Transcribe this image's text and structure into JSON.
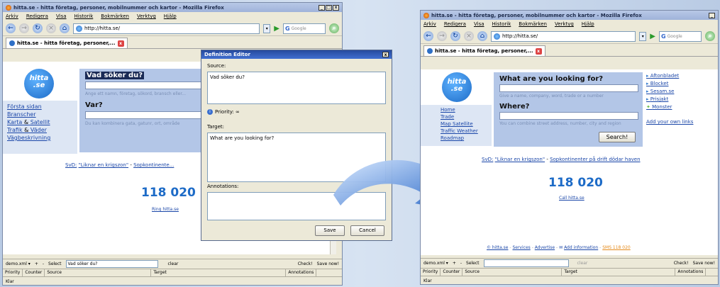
{
  "window_title": "hitta.se - hitta företag, personer, mobilnummer och kartor - Mozilla Firefox",
  "menu": [
    "Arkiv",
    "Redigera",
    "Visa",
    "Historik",
    "Bokmärken",
    "Verktyg",
    "Hjälp"
  ],
  "url": "http://hitta.se/",
  "search_placeholder": "Google",
  "tab_title": "hitta.se - hitta företag, personer,...",
  "logo_text": [
    "hitta",
    ".se"
  ],
  "left_before": {
    "links": [
      "Första sidan",
      "Branscher"
    ],
    "pairs": [
      [
        "Karta",
        "&",
        "Satellit"
      ],
      [
        "Trafik",
        "&",
        "Väder"
      ]
    ],
    "last": "Vägbeskrivning",
    "heading1": "Vad söker du?",
    "hint1": "Ange ett namn, företag, sökord, bransch eller...",
    "heading2": "Var?",
    "hint2": "Du kan kombinera gata, gatunr, ort, område",
    "news": [
      "SvD:",
      "\"Liknar en krigszon\"",
      "-",
      "Sopkontinente..."
    ],
    "number": "118 020",
    "call": "Ring hitta.se"
  },
  "dialog": {
    "title": "Definition Editor",
    "source_label": "Source:",
    "source_value": "Vad söker du?",
    "priority_label": "Priority: ∞",
    "target_label": "Target:",
    "target_value": "What are you looking for?",
    "annotations_label": "Annotations:",
    "save": "Save",
    "cancel": "Cancel"
  },
  "status_before": {
    "file": "demo.xml ▾",
    "plus": "+",
    "minus": "-",
    "select_label": "Select",
    "select_value": "Vad söker du?",
    "clear": "clear",
    "check": "Check!",
    "save_now": "Save now!",
    "cols": [
      "Priority",
      "Counter",
      "Source",
      "Target",
      "Annotations"
    ],
    "status": "Klar"
  },
  "after": {
    "links": [
      "Home",
      "Trade"
    ],
    "pair1": [
      "Map",
      "Satellite"
    ],
    "pair2": [
      "Traffic",
      "Weather"
    ],
    "last": "Roadmap",
    "heading1": "What are you looking for?",
    "hint1": "Give a name, company, word, trade or a number",
    "heading2": "Where?",
    "hint2": "You can combine street address, number, city and region",
    "search_button": "Search!",
    "side_links": [
      "Aftonbladet",
      "Blocket",
      "Sesam.se",
      "Prisjakt",
      "Monster"
    ],
    "add_links": "Add your own links",
    "news": [
      "SvD:",
      "\"Liknar en krigszon\"",
      "-",
      "Sopkontinenter på drift dödar haven"
    ],
    "number": "118 020",
    "call": "Call hitta.se",
    "footer": [
      "© hitta.se",
      "Services",
      "Advertise",
      "Add information",
      "SMS 118 020"
    ]
  },
  "status_after": {
    "file": "demo.xml ▾",
    "select_label": "Select",
    "clear": "clear",
    "check": "Check!",
    "save_now": "Save now!",
    "cols": [
      "Priority",
      "Counter",
      "Source",
      "Target",
      "Annotations"
    ],
    "status": "Klar"
  },
  "colors": {
    "accent_blue": "#1d6bc7",
    "panel_blue": "#b3c6e7",
    "arrow": "#2f7fe0"
  }
}
